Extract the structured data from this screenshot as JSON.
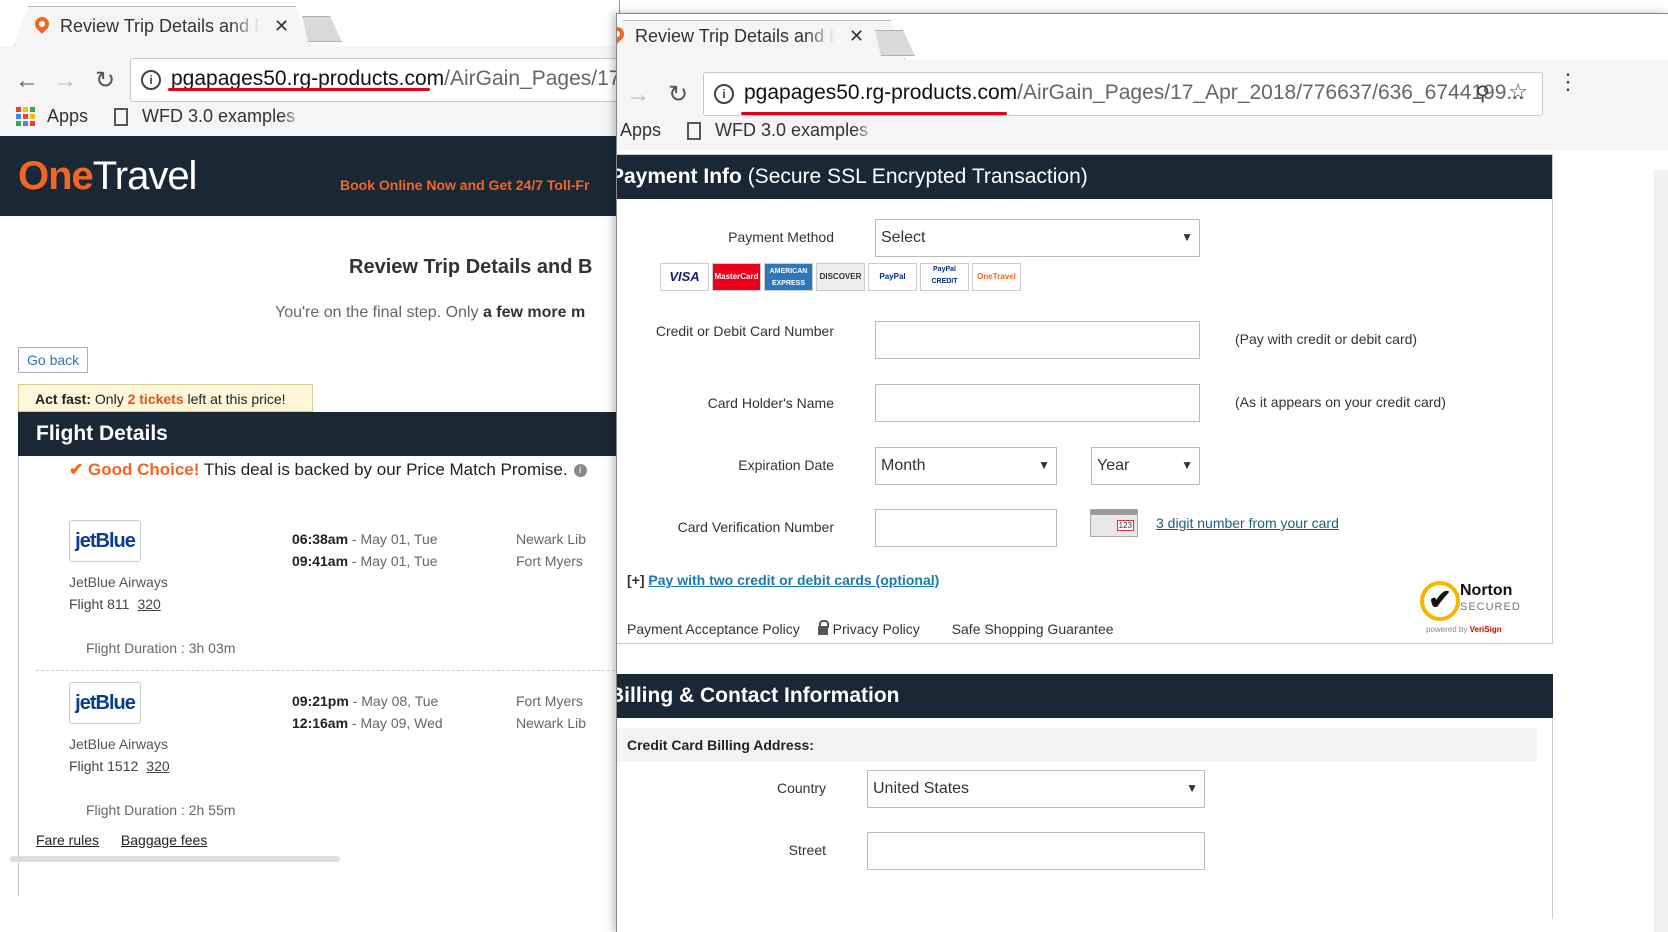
{
  "tab": {
    "title": "Review Trip Details and B"
  },
  "browser": {
    "url_domain": "pgapages50.rg-products.com",
    "url_path_w1": "/AirGain_Pages/17",
    "url_path_w2": "/AirGain_Pages/17_Apr_2018/776637/636_6744199...",
    "bookmarks": {
      "apps": "Apps",
      "wfd": "WFD 3.0 examples se"
    }
  },
  "w1": {
    "logo_one": "One",
    "logo_travel": "Travel",
    "promo": "Book Online Now and Get 24/7 Toll-Fr",
    "review_title": "Review Trip Details and B",
    "review_sub_a": "You're on the final step. Only ",
    "review_sub_b": "a few more m",
    "go_back": "Go back",
    "actfast": {
      "a": "Act fast:",
      "b": " Only ",
      "c": "2 tickets",
      "d": " left at this price!"
    },
    "flight_details": "Flight Details",
    "good_choice": {
      "a": "Good Choice!",
      "b": " This deal is backed by our Price Match Promise."
    },
    "segments": [
      {
        "logo": "jetBlue",
        "airline": "JetBlue Airways",
        "flight": "Flight 811",
        "aircraft": "320",
        "dep_time": "06:38am",
        "dep_date": " - May 01, Tue",
        "arr_time": "09:41am",
        "arr_date": " - May 01, Tue",
        "from": "Newark Lib",
        "to": "Fort Myers",
        "duration": "Flight Duration : 3h 03m"
      },
      {
        "logo": "jetBlue",
        "airline": "JetBlue Airways",
        "flight": "Flight 1512",
        "aircraft": "320",
        "dep_time": "09:21pm",
        "dep_date": " - May 08, Tue",
        "arr_time": "12:16am",
        "arr_date": " - May 09, Wed",
        "from": "Fort Myers",
        "to": "Newark Lib",
        "duration": "Flight Duration : 2h 55m"
      }
    ],
    "fare_rules": "Fare rules",
    "baggage_fees": "Baggage fees"
  },
  "w2": {
    "pay_head_bold": "Payment Info",
    "pay_head_rest": " (Secure SSL Encrypted Transaction)",
    "payment_method_label": "Payment Method",
    "payment_method_value": "Select",
    "cards": [
      "VISA",
      "MasterCard",
      "AMERICAN EXPRESS",
      "DISCOVER",
      "PayPal",
      "PayPal CREDIT",
      "OneTravel"
    ],
    "card_number_label": "Credit or Debit Card Number",
    "card_number_hint": "(Pay with credit or debit card)",
    "holder_label": "Card Holder's Name",
    "holder_hint": "(As it appears on your credit card)",
    "exp_label": "Expiration Date",
    "exp_month": "Month",
    "exp_year": "Year",
    "cvv_label": "Card Verification Number",
    "cvv_img_text": "123",
    "cvv_hint": "3 digit number from your card",
    "two_cards_prefix": "[+] ",
    "two_cards_link": "Pay with two credit or debit cards (optional)",
    "policy1": "Payment Acceptance Policy",
    "policy2": "Privacy Policy",
    "policy3": "Safe Shopping Guarantee",
    "norton": {
      "name": "Norton",
      "secured": "SECURED",
      "powered": "powered by ",
      "verisign": "VeriSign"
    },
    "billing_head": "Billing & Contact Information",
    "ccba": "Credit Card Billing Address:",
    "country_label": "Country",
    "country_value": "United States",
    "street_label": "Street"
  },
  "colors": {
    "accent": "#f26522",
    "header": "#1a2836",
    "link": "#1a7ab0",
    "underline": "#e2001a"
  }
}
